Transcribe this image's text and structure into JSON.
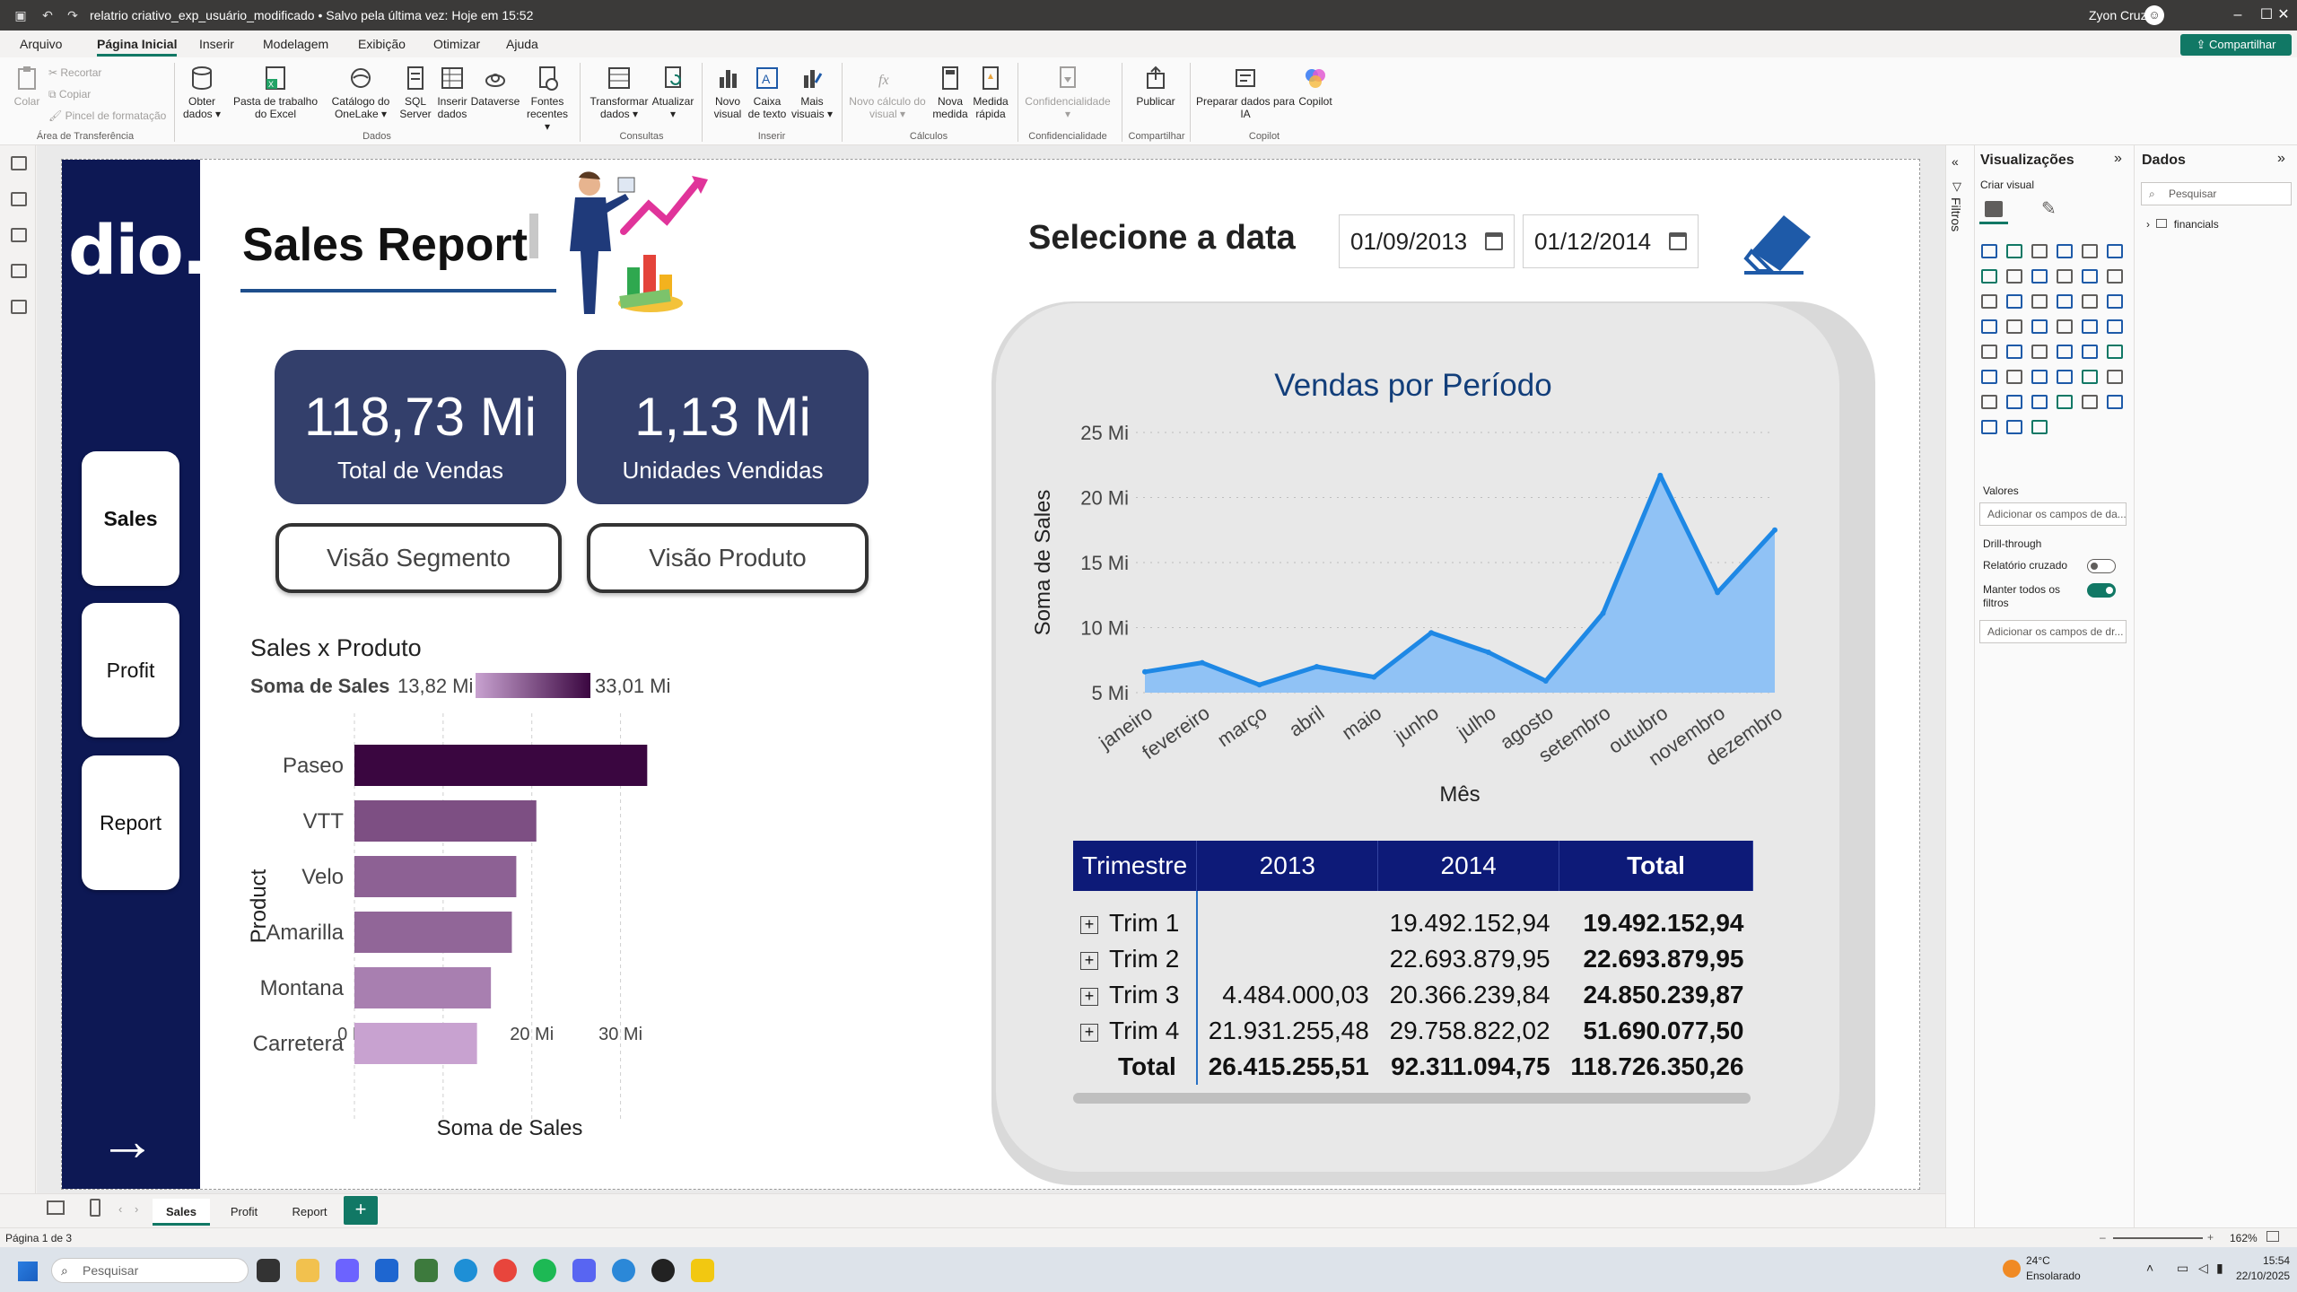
{
  "titlebar": {
    "file_title": "relatrio criativo_exp_usuário_modificado • Salvo pela última vez: Hoje em 15:52",
    "user_name": "Zyon Cruz"
  },
  "ribbon": {
    "tabs": [
      "Arquivo",
      "Página Inicial",
      "Inserir",
      "Modelagem",
      "Exibição",
      "Otimizar",
      "Ajuda"
    ],
    "share_label": "Compartilhar",
    "clipboard": {
      "paste": "Colar",
      "cut": "Recortar",
      "copy": "Copiar",
      "format_painter": "Pincel de formatação",
      "group": "Área de Transferência"
    },
    "data": {
      "get_data": "Obter dados",
      "excel": "Pasta de trabalho do Excel",
      "onelake": "Catálogo do OneLake",
      "sql": "SQL Server",
      "enter_data": "Inserir dados",
      "dataverse": "Dataverse",
      "recent": "Fontes recentes",
      "group": "Dados"
    },
    "queries": {
      "transform": "Transformar dados",
      "refresh": "Atualizar",
      "group": "Consultas"
    },
    "insert": {
      "new_visual": "Novo visual",
      "text_box": "Caixa de texto",
      "more_visuals": "Mais visuais",
      "group": "Inserir"
    },
    "calc": {
      "new_calc": "Novo cálculo do visual",
      "new_measure": "Nova medida",
      "quick_measure": "Medida rápida",
      "group": "Cálculos"
    },
    "sensitivity": {
      "label": "Confidencialidade",
      "group": "Confidencialidade"
    },
    "share": {
      "publish": "Publicar",
      "group": "Compartilhar"
    },
    "copilot": {
      "prepare": "Preparar dados para IA",
      "copilot": "Copilot",
      "group": "Copilot"
    }
  },
  "report": {
    "logo_text": "dio.",
    "nav": {
      "sales": "Sales",
      "profit": "Profit",
      "report": "Report",
      "arrow": "→"
    },
    "title": "Sales Report",
    "kpis": [
      {
        "value": "118,73 Mi",
        "label": "Total de Vendas"
      },
      {
        "value": "1,13 Mi",
        "label": "Unidades Vendidas"
      }
    ],
    "buttons": {
      "segment": "Visão Segmento",
      "product": "Visão Produto"
    },
    "date_heading": "Selecione a data",
    "date_start": "01/09/2013",
    "date_end": "01/12/2014",
    "colors": {
      "nav": "#0d1854",
      "kpi": "#333f6b",
      "bar_light": "#c8a2d0",
      "bar_dark": "#3a0640",
      "line": "#1e88e5",
      "area": "#90c2f5",
      "matrix_header": "#0d1a78"
    }
  },
  "bar_chart": {
    "title": "Sales x Produto",
    "legend_label": "Soma de  Sales",
    "legend_min": "13,82 Mi",
    "legend_max": "33,01 Mi"
  },
  "line_chart": {
    "title": "Vendas por Período"
  },
  "chart_data": [
    {
      "type": "bar",
      "orientation": "horizontal",
      "title": "Sales x Produto",
      "categories": [
        "Paseo",
        "VTT",
        "Velo",
        "Amarilla",
        "Montana",
        "Carretera"
      ],
      "values": [
        33.01,
        20.51,
        18.25,
        17.75,
        15.39,
        13.82
      ],
      "unit": "Mi",
      "xlabel": "Soma de Sales",
      "ylabel": "Product",
      "xticks": [
        "0 Mi",
        "10 Mi",
        "20 Mi",
        "30 Mi"
      ],
      "xlim": [
        0,
        35
      ],
      "grid": "vertical dashed",
      "legend": "top, color scale"
    },
    {
      "type": "area",
      "title": "Vendas por Período",
      "categories": [
        "janeiro",
        "fevereiro",
        "março",
        "abril",
        "maio",
        "junho",
        "julho",
        "agosto",
        "setembro",
        "outubro",
        "novembro",
        "dezembro"
      ],
      "values": [
        6.6,
        7.3,
        5.6,
        7.0,
        6.2,
        9.6,
        8.1,
        5.9,
        11.1,
        21.7,
        12.7,
        17.5
      ],
      "unit": "Mi",
      "xlabel": "Mês",
      "ylabel": "Soma de Sales",
      "yticks": [
        "5 Mi",
        "10 Mi",
        "15 Mi",
        "20 Mi",
        "25 Mi"
      ],
      "ylim": [
        5,
        25
      ],
      "grid": "horizontal dotted"
    },
    {
      "type": "table",
      "columns": [
        "Trimestre",
        "2013",
        "2014",
        "Total"
      ],
      "rows": [
        [
          "Trim 1",
          "",
          "19.492.152,94",
          "19.492.152,94"
        ],
        [
          "Trim 2",
          "",
          "22.693.879,95",
          "22.693.879,95"
        ],
        [
          "Trim 3",
          "4.484.000,03",
          "20.366.239,84",
          "24.850.239,87"
        ],
        [
          "Trim 4",
          "21.931.255,48",
          "29.758.822,02",
          "51.690.077,50"
        ]
      ],
      "total_row": [
        "Total",
        "26.415.255,51",
        "92.311.094,75",
        "118.726.350,26"
      ]
    }
  ],
  "panes": {
    "filters": "Filtros",
    "viz_title": "Visualizações",
    "build_visual": "Criar visual",
    "values_label": "Valores",
    "values_placeholder": "Adicionar os campos de da...",
    "drill_label": "Drill-through",
    "cross_report": "Relatório cruzado",
    "keep_filters": "Manter todos os filtros",
    "drill_placeholder": "Adicionar os campos de dr...",
    "data_title": "Dados",
    "search_placeholder": "Pesquisar",
    "table_name": "financials"
  },
  "pages": {
    "tabs": [
      "Sales",
      "Profit",
      "Report"
    ],
    "add": "+",
    "status": "Página 1 de 3",
    "zoom": "162%"
  },
  "taskbar": {
    "search_placeholder": "Pesquisar",
    "weather_temp": "24°C",
    "weather_text": "Ensolarado",
    "time": "15:54",
    "date": "22/10/2025"
  }
}
